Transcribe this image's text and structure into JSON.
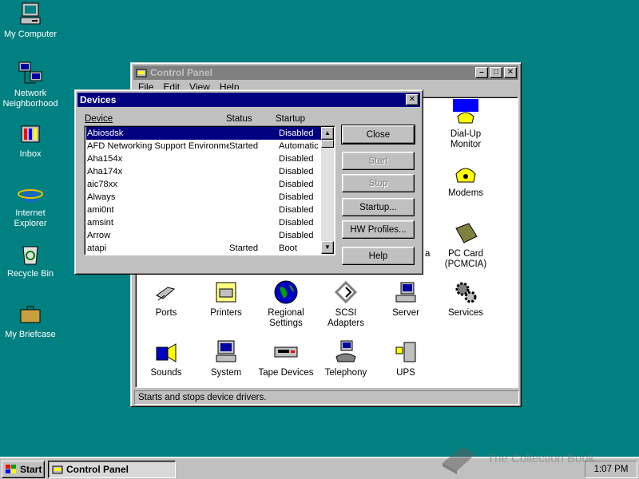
{
  "desktop": {
    "icons": [
      {
        "label": "My Computer"
      },
      {
        "label": "Network Neighborhood"
      },
      {
        "label": "Inbox"
      },
      {
        "label": "Internet Explorer"
      },
      {
        "label": "Recycle Bin"
      },
      {
        "label": "My Briefcase"
      }
    ]
  },
  "control_panel": {
    "title": "Control Panel",
    "menu": [
      "File",
      "Edit",
      "View",
      "Help"
    ],
    "icons": [
      {
        "label": "Dial-Up Monitor"
      },
      {
        "label": "Modems"
      },
      {
        "label": "PC Card (PCMCIA)"
      },
      {
        "label": "Ports"
      },
      {
        "label": "Printers"
      },
      {
        "label": "Regional Settings"
      },
      {
        "label": "SCSI Adapters"
      },
      {
        "label": "Server"
      },
      {
        "label": "Services"
      },
      {
        "label": "Sounds"
      },
      {
        "label": "System"
      },
      {
        "label": "Tape Devices"
      },
      {
        "label": "Telephony"
      },
      {
        "label": "UPS"
      },
      {
        "label": "a"
      }
    ],
    "status": "Starts and stops device drivers."
  },
  "devices": {
    "title": "Devices",
    "columns": {
      "device": "Device",
      "status": "Status",
      "startup": "Startup"
    },
    "rows": [
      {
        "name": "Abiosdsk",
        "status": "",
        "startup": "Disabled"
      },
      {
        "name": "AFD Networking Support Environment",
        "status": "Started",
        "startup": "Automatic"
      },
      {
        "name": "Aha154x",
        "status": "",
        "startup": "Disabled"
      },
      {
        "name": "Aha174x",
        "status": "",
        "startup": "Disabled"
      },
      {
        "name": "aic78xx",
        "status": "",
        "startup": "Disabled"
      },
      {
        "name": "Always",
        "status": "",
        "startup": "Disabled"
      },
      {
        "name": "ami0nt",
        "status": "",
        "startup": "Disabled"
      },
      {
        "name": "amsint",
        "status": "",
        "startup": "Disabled"
      },
      {
        "name": "Arrow",
        "status": "",
        "startup": "Disabled"
      },
      {
        "name": "atapi",
        "status": "Started",
        "startup": "Boot"
      }
    ],
    "selected_index": 0,
    "buttons": {
      "close": "Close",
      "start": "Start",
      "stop": "Stop",
      "startup": "Startup...",
      "hw_profiles": "HW Profiles...",
      "help": "Help"
    }
  },
  "taskbar": {
    "start_label": "Start",
    "task_label": "Control Panel",
    "clock": "1:07 PM"
  },
  "watermark": "The Collection Book"
}
